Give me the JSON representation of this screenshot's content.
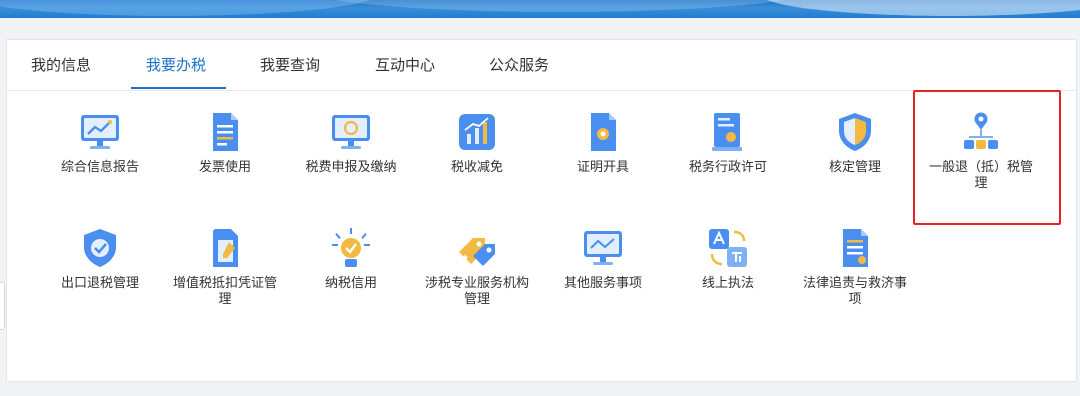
{
  "tabs": [
    {
      "label": "我的信息"
    },
    {
      "label": "我要办税"
    },
    {
      "label": "我要查询"
    },
    {
      "label": "互动中心"
    },
    {
      "label": "公众服务"
    }
  ],
  "active_tab": "我要办税",
  "items": [
    {
      "label": "综合信息报告",
      "icon": "monitor-chart-icon"
    },
    {
      "label": "发票使用",
      "icon": "invoice-document-icon"
    },
    {
      "label": "税费申报及缴纳",
      "icon": "monitor-yen-icon"
    },
    {
      "label": "税收减免",
      "icon": "bar-chart-icon"
    },
    {
      "label": "证明开具",
      "icon": "certificate-document-icon"
    },
    {
      "label": "税务行政许可",
      "icon": "license-badge-icon"
    },
    {
      "label": "核定管理",
      "icon": "shield-icon"
    },
    {
      "label": "一般退（抵）税管理",
      "icon": "location-org-icon"
    },
    {
      "label": "出口退税管理",
      "icon": "shield-check-icon"
    },
    {
      "label": "增值税抵扣凭证管理",
      "icon": "document-pen-icon"
    },
    {
      "label": "纳税信用",
      "icon": "medal-icon"
    },
    {
      "label": "涉税专业服务机构管理",
      "icon": "tags-icon"
    },
    {
      "label": "其他服务事项",
      "icon": "monitor-line-icon"
    },
    {
      "label": "线上执法",
      "icon": "translate-icon"
    },
    {
      "label": "法律追责与救济事项",
      "icon": "document-list-icon"
    }
  ],
  "colors": {
    "accent": "#1a73c9",
    "highlight": "#e8231f",
    "icon_blue": "#4a8ff0",
    "icon_orange": "#f4b940"
  }
}
